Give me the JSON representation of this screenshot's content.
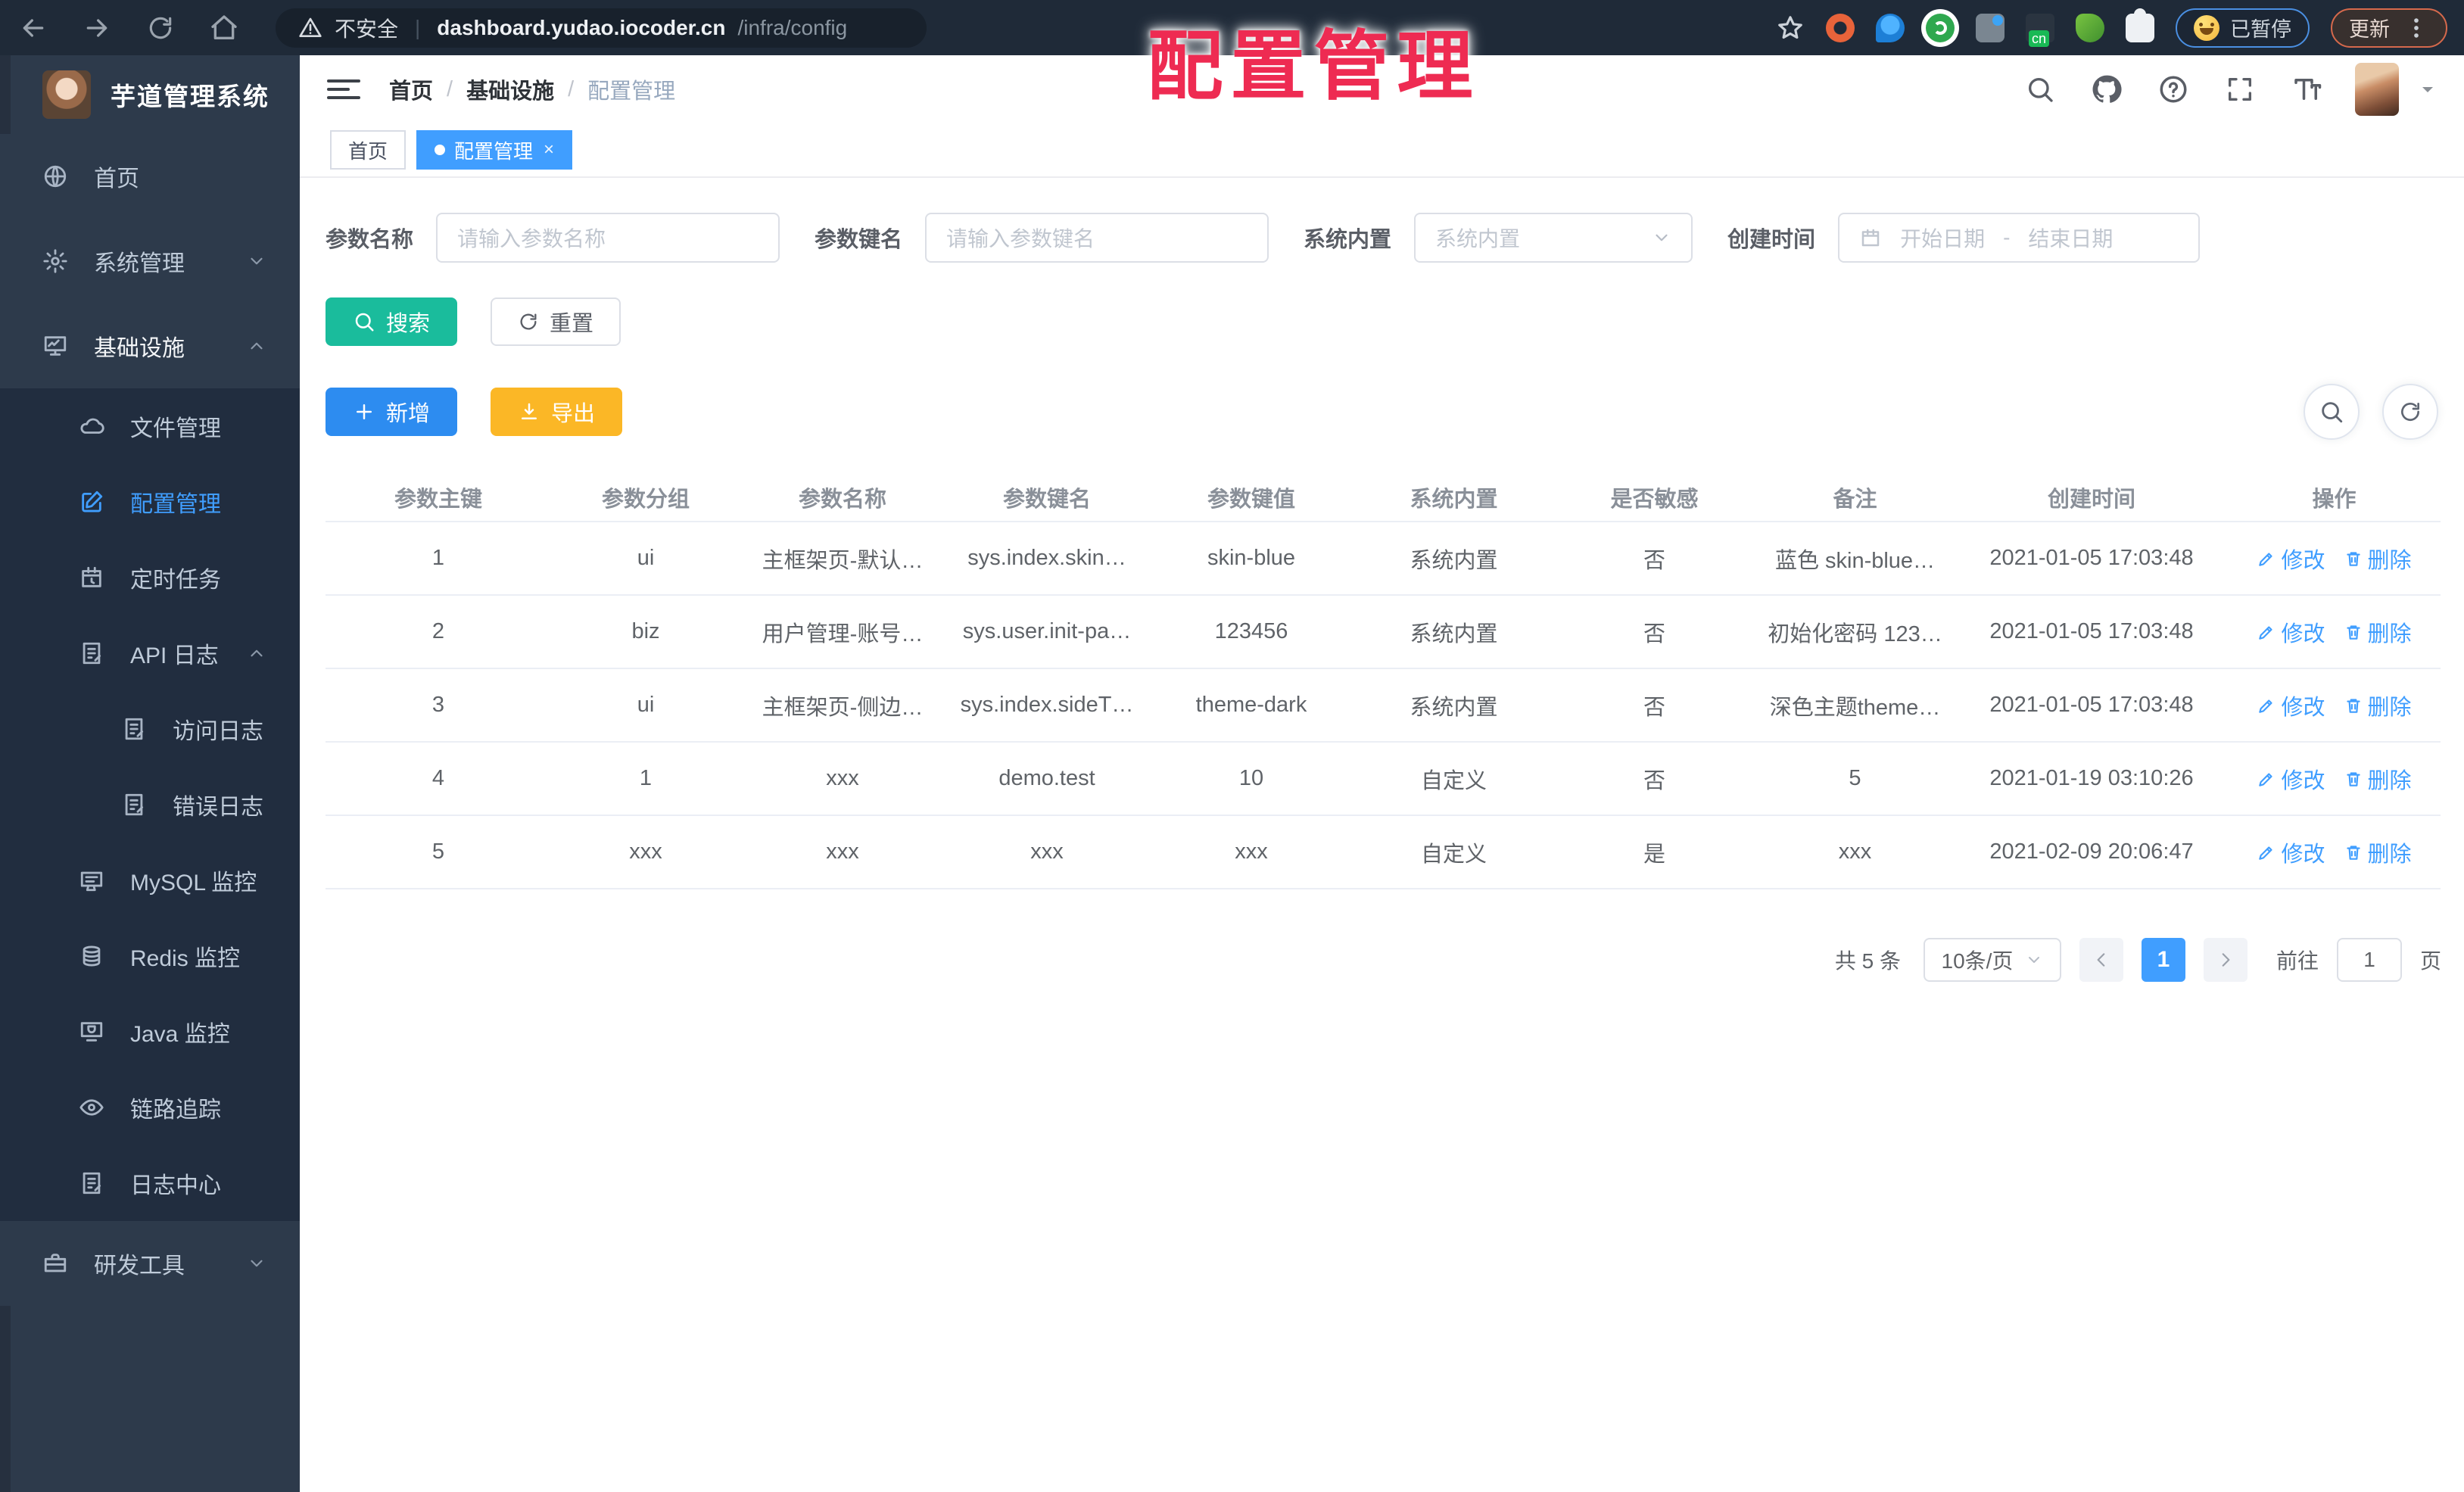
{
  "browser": {
    "security_label": "不安全",
    "url_host": "dashboard.yudao.iocoder.cn",
    "url_path": "/infra/config",
    "paused_label": "已暂停",
    "update_label": "更新"
  },
  "overlay_title": "配置管理",
  "colors": {
    "primary": "#409eff",
    "search_button": "#1abc9c",
    "add_button": "#2d8cf0",
    "export_button": "#fbb726",
    "sidebar_bg": "#2d3a4b",
    "submenu_bg": "#212d3f",
    "overlay_red": "#ee2b52"
  },
  "sidebar": {
    "logo_title": "芋道管理系统",
    "items": [
      {
        "label": "首页",
        "icon": "globe",
        "level": 1,
        "chevron": "",
        "active": false
      },
      {
        "label": "系统管理",
        "icon": "gear",
        "level": 1,
        "chevron": "down",
        "active": false
      },
      {
        "label": "基础设施",
        "icon": "monitor",
        "level": 1,
        "chevron": "up",
        "active": false,
        "open": true
      },
      {
        "label": "文件管理",
        "icon": "cloud",
        "level": 2,
        "chevron": "",
        "active": false
      },
      {
        "label": "配置管理",
        "icon": "editsq",
        "level": 2,
        "chevron": "",
        "active": true
      },
      {
        "label": "定时任务",
        "icon": "timer",
        "level": 2,
        "chevron": "",
        "active": false
      },
      {
        "label": "API 日志",
        "icon": "log",
        "level": 2,
        "chevron": "up",
        "active": false
      },
      {
        "label": "访问日志",
        "icon": "log",
        "level": 3,
        "chevron": "",
        "active": false
      },
      {
        "label": "错误日志",
        "icon": "log",
        "level": 3,
        "chevron": "",
        "active": false
      },
      {
        "label": "MySQL 监控",
        "icon": "mysql",
        "level": 2,
        "chevron": "",
        "active": false
      },
      {
        "label": "Redis 监控",
        "icon": "redis",
        "level": 2,
        "chevron": "",
        "active": false
      },
      {
        "label": "Java 监控",
        "icon": "java",
        "level": 2,
        "chevron": "",
        "active": false
      },
      {
        "label": "链路追踪",
        "icon": "eye",
        "level": 2,
        "chevron": "",
        "active": false
      },
      {
        "label": "日志中心",
        "icon": "log",
        "level": 2,
        "chevron": "",
        "active": false
      },
      {
        "label": "研发工具",
        "icon": "briefcase",
        "level": 1,
        "chevron": "down",
        "active": false
      }
    ]
  },
  "header": {
    "breadcrumb": [
      "首页",
      "基础设施",
      "配置管理"
    ]
  },
  "tabs": [
    {
      "label": "首页",
      "active": false
    },
    {
      "label": "配置管理",
      "active": true,
      "closable": true
    }
  ],
  "filters": {
    "name_label": "参数名称",
    "name_placeholder": "请输入参数名称",
    "key_label": "参数键名",
    "key_placeholder": "请输入参数键名",
    "builtin_label": "系统内置",
    "builtin_placeholder": "系统内置",
    "time_label": "创建时间",
    "date_start_placeholder": "开始日期",
    "date_separator": "-",
    "date_end_placeholder": "结束日期"
  },
  "toolbar": {
    "search_label": "搜索",
    "reset_label": "重置",
    "add_label": "新增",
    "export_label": "导出"
  },
  "table": {
    "columns": [
      "参数主键",
      "参数分组",
      "参数名称",
      "参数键名",
      "参数键值",
      "系统内置",
      "是否敏感",
      "备注",
      "创建时间",
      "操作"
    ],
    "row_actions": [
      "修改",
      "删除"
    ],
    "rows": [
      [
        "1",
        "ui",
        "主框架页-默认…",
        "sys.index.skin…",
        "skin-blue",
        "系统内置",
        "否",
        "蓝色 skin-blue…",
        "2021-01-05 17:03:48"
      ],
      [
        "2",
        "biz",
        "用户管理-账号…",
        "sys.user.init-pa…",
        "123456",
        "系统内置",
        "否",
        "初始化密码 123…",
        "2021-01-05 17:03:48"
      ],
      [
        "3",
        "ui",
        "主框架页-侧边…",
        "sys.index.sideT…",
        "theme-dark",
        "系统内置",
        "否",
        "深色主题theme…",
        "2021-01-05 17:03:48"
      ],
      [
        "4",
        "1",
        "xxx",
        "demo.test",
        "10",
        "自定义",
        "否",
        "5",
        "2021-01-19 03:10:26"
      ],
      [
        "5",
        "xxx",
        "xxx",
        "xxx",
        "xxx",
        "自定义",
        "是",
        "xxx",
        "2021-02-09 20:06:47"
      ]
    ]
  },
  "pagination": {
    "total_label": "共 5 条",
    "page_size_label": "10条/页",
    "current_page": "1",
    "goto_label": "前往",
    "goto_value": "1",
    "page_unit_label": "页"
  }
}
